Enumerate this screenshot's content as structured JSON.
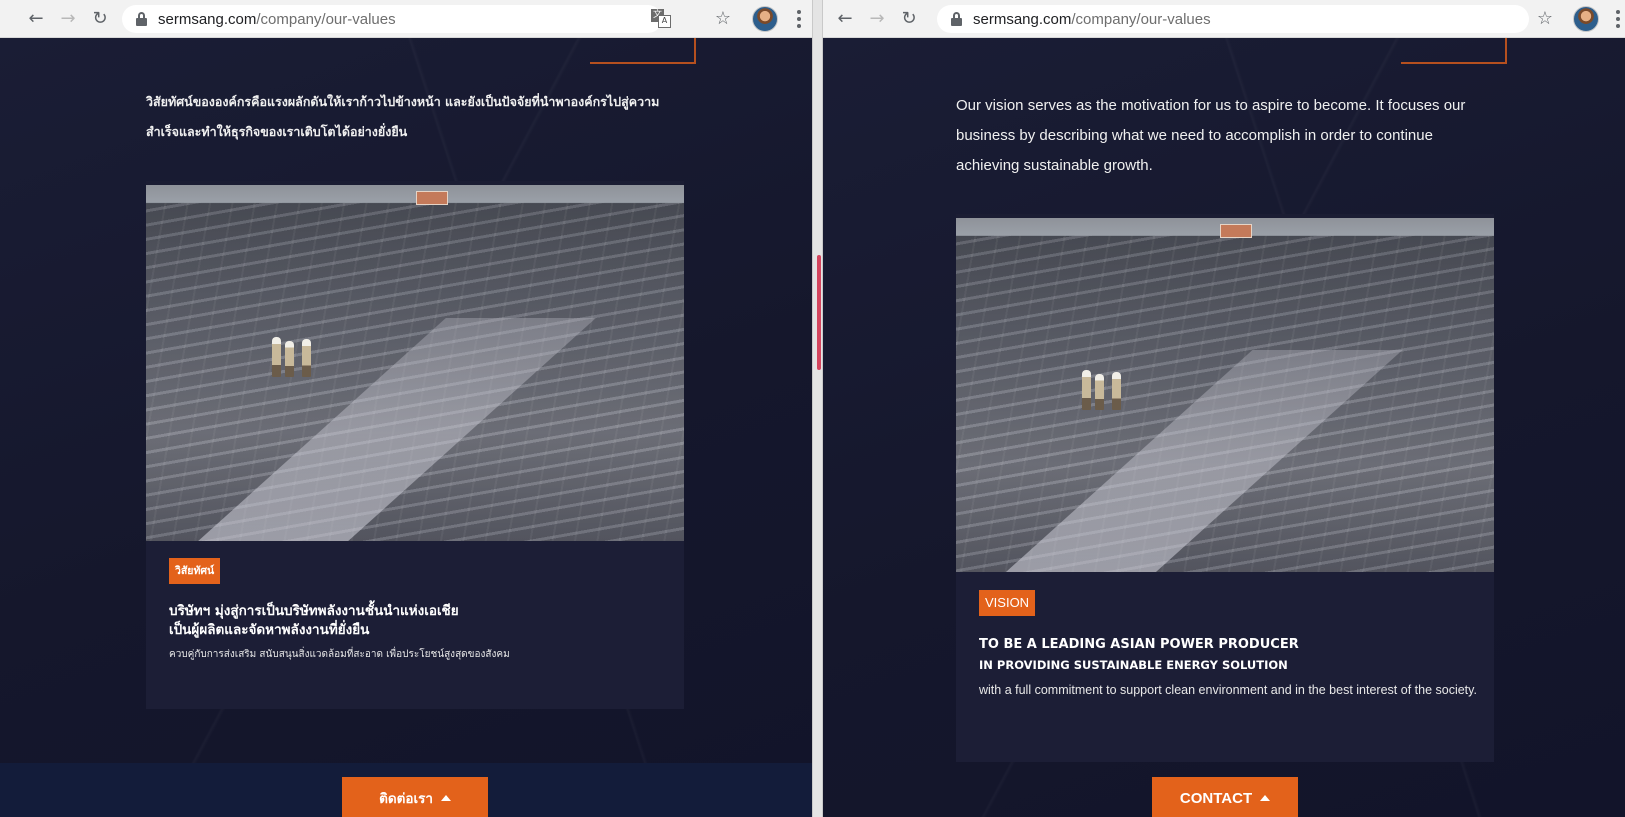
{
  "browser": {
    "url_domain": "sermsang.com",
    "url_path": "/company/our-values"
  },
  "left_page": {
    "language": "th",
    "intro_text": "วิสัยทัศน์ขององค์กรคือแรงผลักดันให้เราก้าวไปข้างหน้า และยังเป็นปัจจัยที่นำพาองค์กรไปสู่ความสำเร็จและทำให้ธุรกิจของเราเติบโตได้อย่างยั่งยืน",
    "badge": "วิสัยทัศน์",
    "headline_line1": "บริษัทฯ มุ่งสู่การเป็นบริษัทพลังงานชั้นนำแห่งเอเชีย",
    "headline_line2": "เป็นผู้ผลิตและจัดหาพลังงานที่ยั่งยืน",
    "description": "ควบคู่กับการส่งเสริม สนับสนุนสิ่งแวดล้อมที่สะอาด เพื่อประโยชน์สูงสุดของสังคม",
    "contact_button": "ติดต่อเรา"
  },
  "right_page": {
    "language": "en",
    "intro_text": "Our vision serves as the motivation for us to aspire to become. It focuses our business by describing what we need to accomplish in order to continue achieving sustainable growth.",
    "badge": "VISION",
    "headline_line1": "TO BE A LEADING ASIAN POWER PRODUCER",
    "headline_line2": "IN PROVIDING SUSTAINABLE ENERGY SOLUTION",
    "description": "with a full commitment to support clean environment and in the best interest of the society.",
    "contact_button": "CONTACT"
  },
  "icons": {
    "back": "arrow-left-icon",
    "forward": "arrow-right-icon",
    "reload": "reload-icon",
    "lock": "lock-icon",
    "translate": "translate-icon",
    "bookmark": "star-icon",
    "profile": "avatar",
    "menu": "kebab-menu-icon",
    "contact_caret": "caret-up-icon"
  },
  "colors": {
    "accent_orange": "#e3621b",
    "page_background": "#16182e",
    "footer_band": "#131c3a",
    "browser_toolbar": "#f2f2f2"
  }
}
